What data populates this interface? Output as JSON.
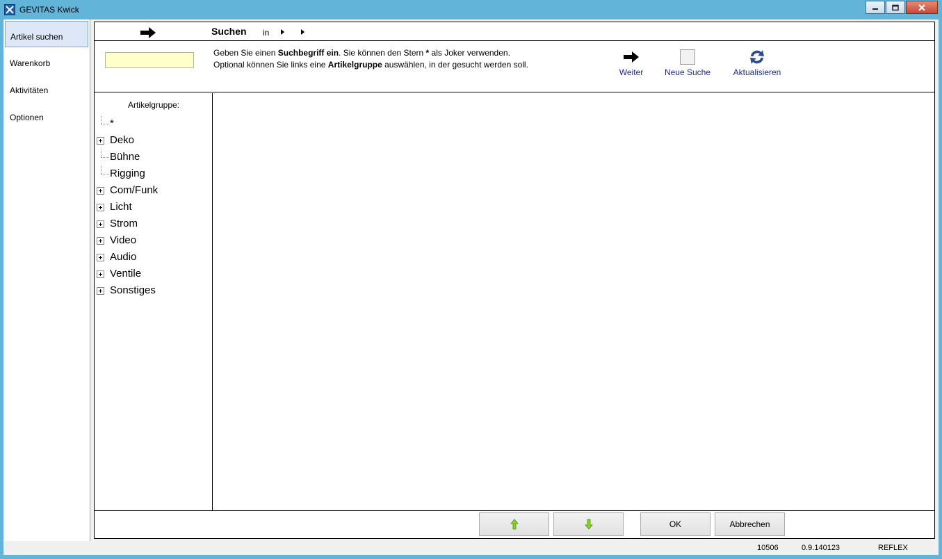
{
  "window": {
    "title": "GEVITAS Kwick",
    "minimize_icon": "minimize-icon",
    "maximize_icon": "maximize-icon",
    "close_icon": "close-icon"
  },
  "sidebar": {
    "items": [
      {
        "label": "Artikel suchen",
        "active": true
      },
      {
        "label": "Warenkorb",
        "active": false
      },
      {
        "label": "Aktivitäten",
        "active": false
      },
      {
        "label": "Optionen",
        "active": false
      }
    ]
  },
  "topbar": {
    "arrow_icon": "arrow-right-icon",
    "title": "Suchen",
    "in_label": "in"
  },
  "search": {
    "value": "",
    "placeholder": "",
    "hint_parts": [
      {
        "text": "Geben Sie einen ",
        "bold": false
      },
      {
        "text": "Suchbegriff ein",
        "bold": true
      },
      {
        "text": ". Sie können den Stern ",
        "bold": false
      },
      {
        "text": "*",
        "bold": true
      },
      {
        "text": " als Joker verwenden. Optional können Sie links eine ",
        "bold": false
      },
      {
        "text": "Artikelgruppe",
        "bold": true
      },
      {
        "text": " auswählen, in der gesucht werden soll.",
        "bold": false
      }
    ]
  },
  "toolbar": {
    "weiter_label": "Weiter",
    "neue_suche_label": "Neue Suche",
    "aktualisieren_label": "Aktualisieren",
    "text_color": "#1c2a8c"
  },
  "groups": {
    "title": "Artikelgruppe:",
    "items": [
      {
        "label": "*",
        "expandable": false
      },
      {
        "label": "Deko",
        "expandable": true
      },
      {
        "label": "Bühne",
        "expandable": false
      },
      {
        "label": "Rigging",
        "expandable": false
      },
      {
        "label": "Com/Funk",
        "expandable": true
      },
      {
        "label": "Licht",
        "expandable": true
      },
      {
        "label": "Strom",
        "expandable": true
      },
      {
        "label": "Video",
        "expandable": true
      },
      {
        "label": "Audio",
        "expandable": true
      },
      {
        "label": "Ventile",
        "expandable": true
      },
      {
        "label": "Sonstiges",
        "expandable": true
      }
    ]
  },
  "buttons": {
    "up_icon": "arrow-up-icon",
    "down_icon": "arrow-down-icon",
    "ok_label": "OK",
    "cancel_label": "Abbrechen",
    "arrow_color": "#7cc21e"
  },
  "status": {
    "id": "10506",
    "version": "0.9.140123",
    "user": "REFLEX"
  }
}
